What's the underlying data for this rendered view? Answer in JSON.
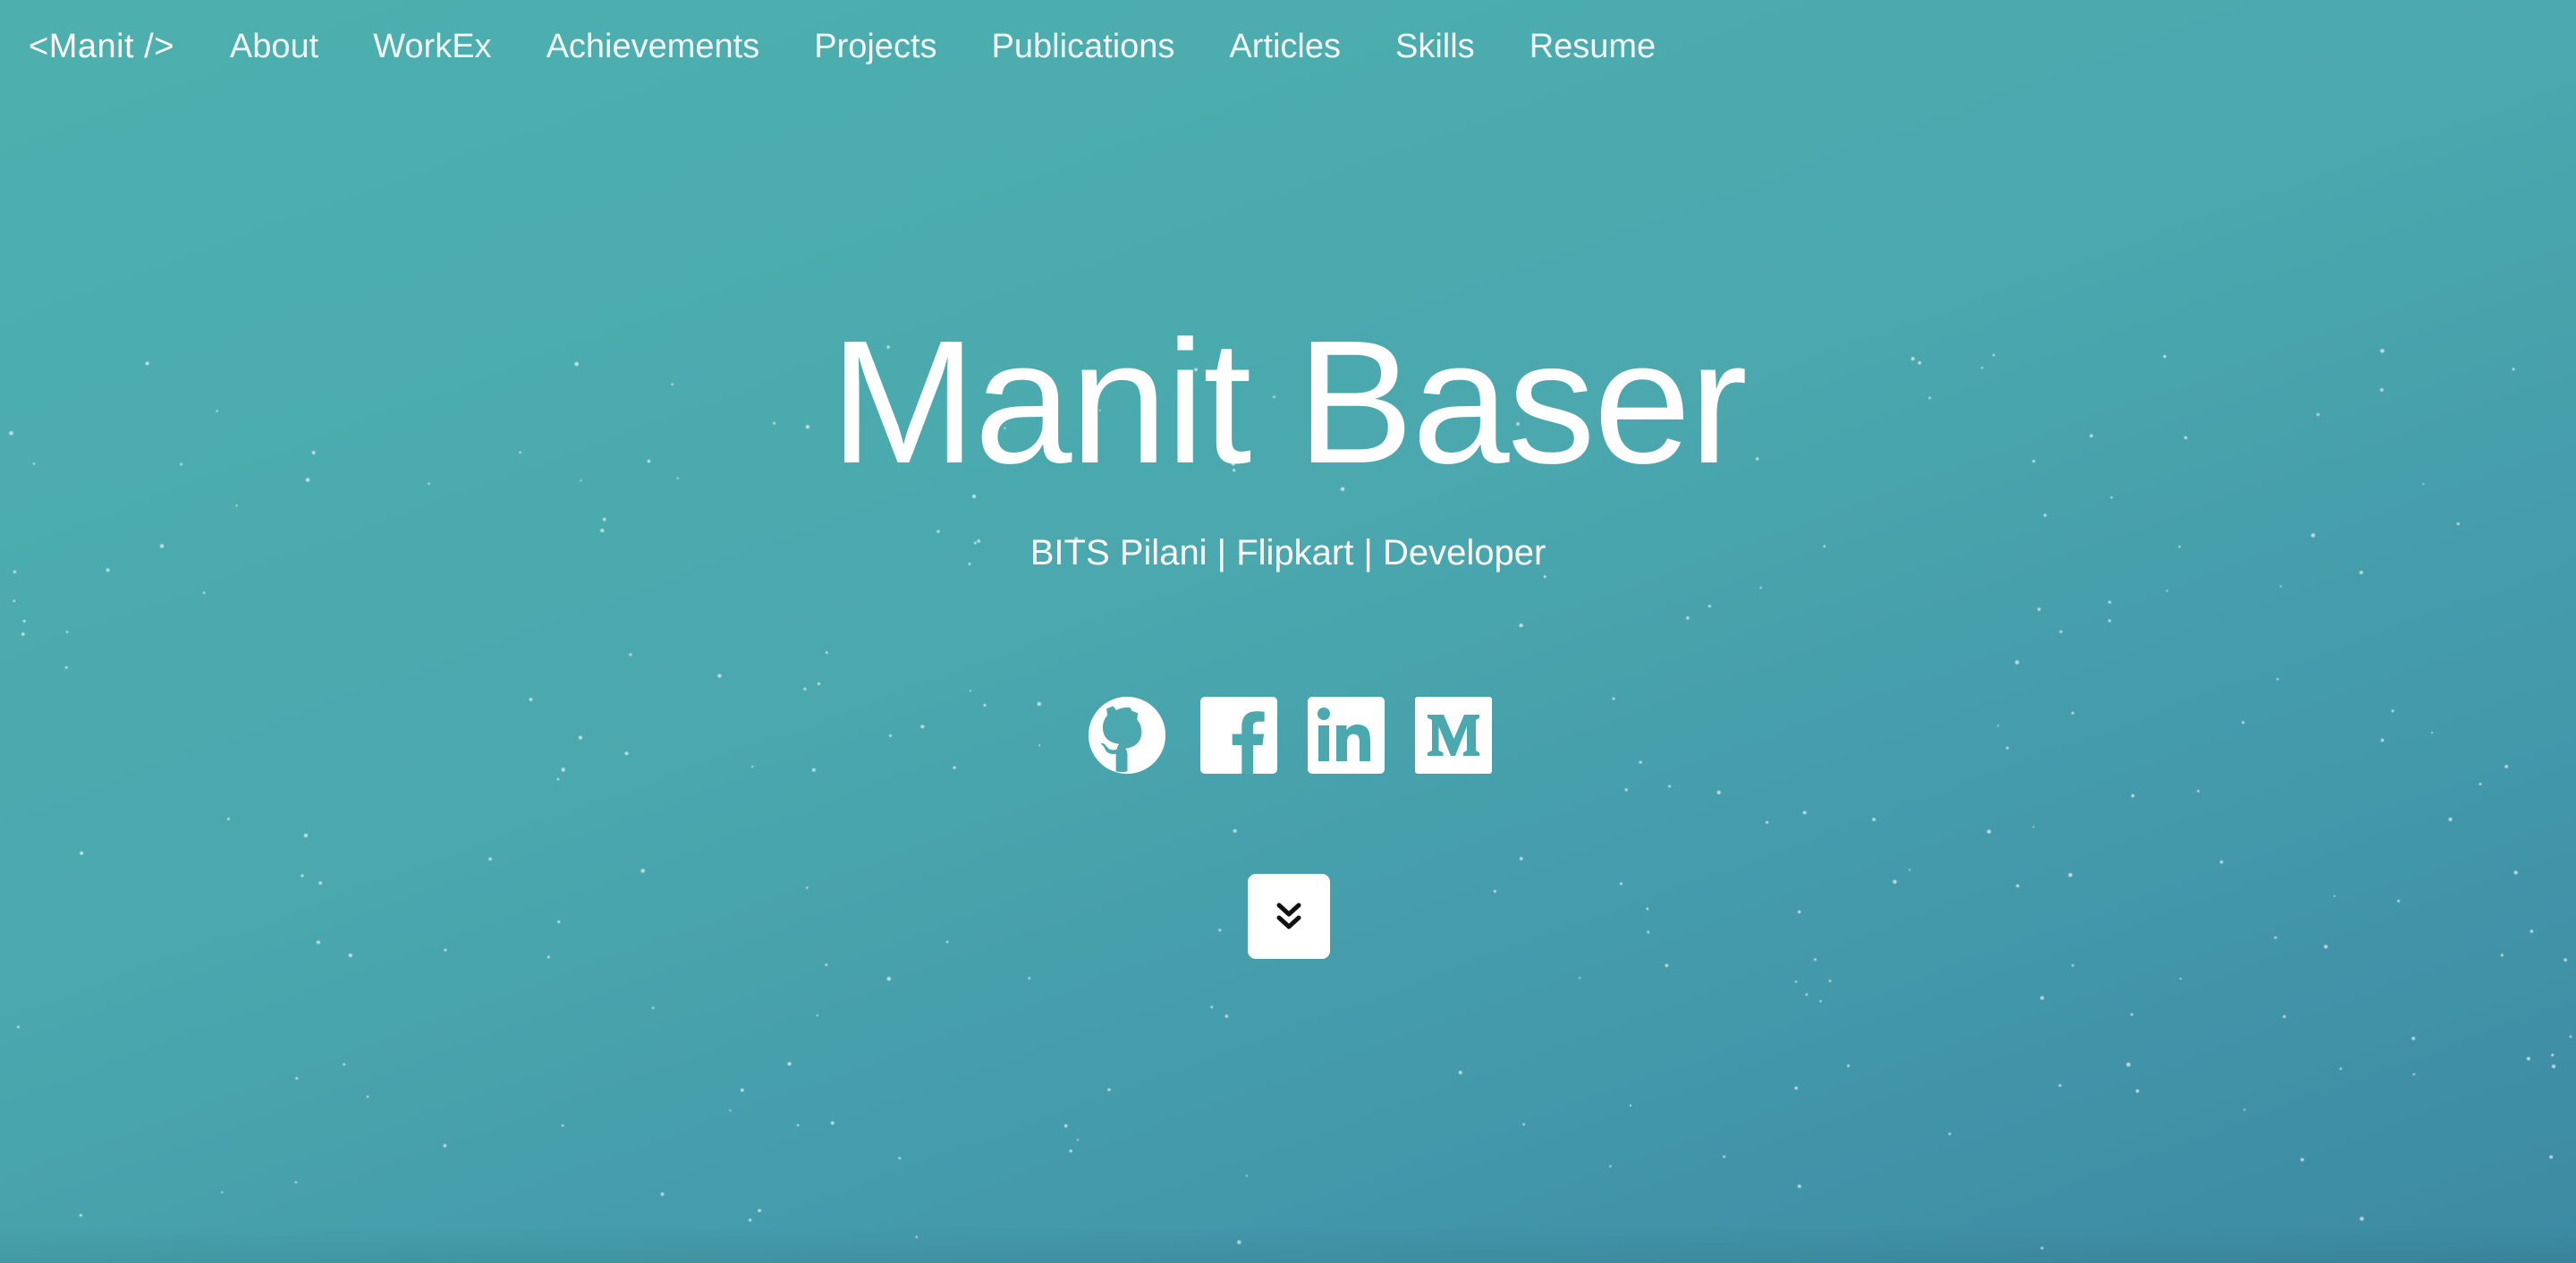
{
  "brand": "<Manit />",
  "nav": {
    "items": [
      {
        "label": "About"
      },
      {
        "label": "WorkEx"
      },
      {
        "label": "Achievements"
      },
      {
        "label": "Projects"
      },
      {
        "label": "Publications"
      },
      {
        "label": "Articles"
      },
      {
        "label": "Skills"
      },
      {
        "label": "Resume"
      }
    ]
  },
  "hero": {
    "title": "Manit Baser",
    "subtitle": "BITS Pilani | Flipkart | Developer"
  },
  "social": [
    {
      "icon": "github-icon"
    },
    {
      "icon": "facebook-icon"
    },
    {
      "icon": "linkedin-icon"
    },
    {
      "icon": "medium-icon"
    }
  ],
  "scroll": {
    "icon": "double-chevron-down-icon"
  },
  "colors": {
    "background_start": "#4db0ae",
    "background_end": "#3c8aa3",
    "text": "#ffffff",
    "icon_glyph": "#4aa8ae"
  }
}
